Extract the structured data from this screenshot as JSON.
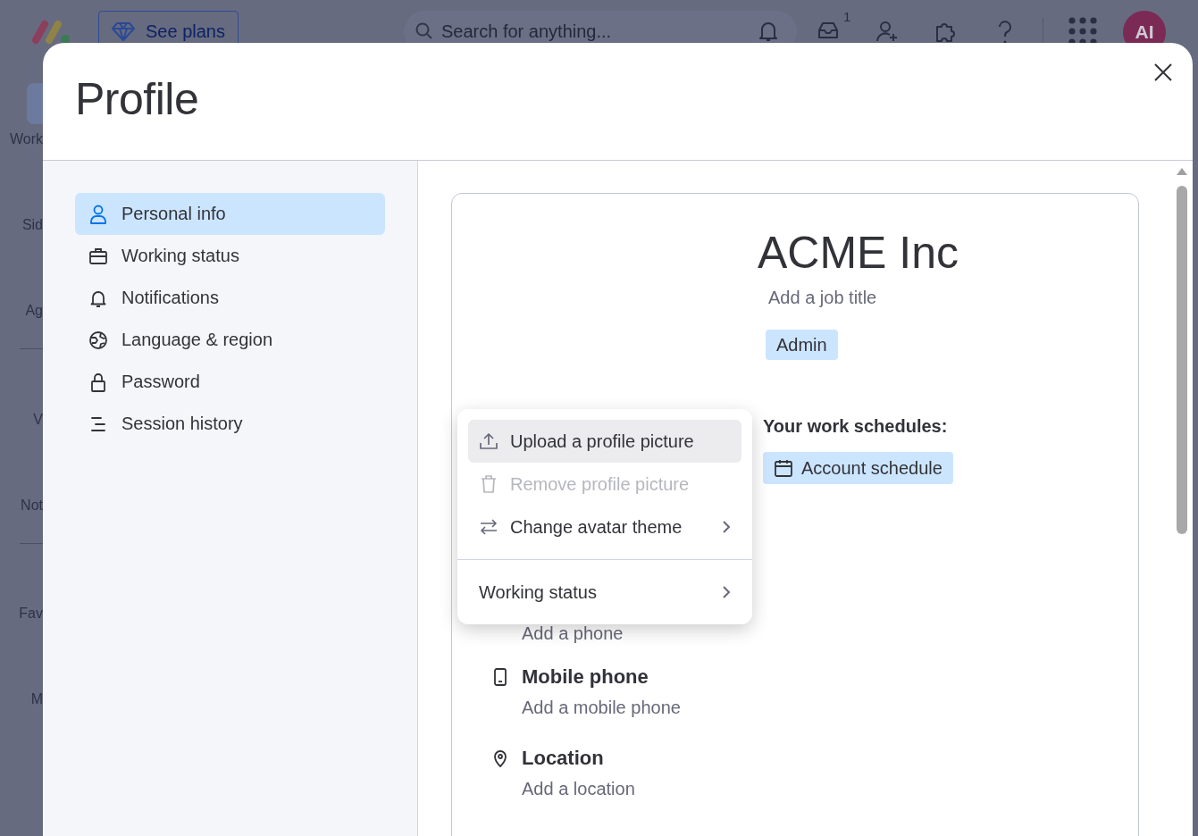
{
  "topbar": {
    "see_plans": "See plans",
    "search": {
      "placeholder": "Search for anything..."
    },
    "inbox_badge": "1",
    "avatar": "AI"
  },
  "app_sidebar": {
    "items": [
      {
        "label": "Work",
        "selected": true
      },
      {
        "label": "Sid",
        "selected": false
      },
      {
        "label": "Ag",
        "selected": false
      },
      {
        "label": "V",
        "selected": false
      },
      {
        "label": "Not",
        "selected": false
      },
      {
        "label": "Fav",
        "selected": false
      },
      {
        "label": "M",
        "selected": false
      }
    ]
  },
  "dialog": {
    "title": "Profile"
  },
  "nav": {
    "items": [
      {
        "kind": "person",
        "label": "Personal info",
        "selected": true
      },
      {
        "kind": "briefcase",
        "label": "Working status",
        "selected": false
      },
      {
        "kind": "bell",
        "label": "Notifications",
        "selected": false
      },
      {
        "kind": "globe",
        "label": "Language & region",
        "selected": false
      },
      {
        "kind": "lock",
        "label": "Password",
        "selected": false
      },
      {
        "kind": "lines",
        "label": "Session history",
        "selected": false
      }
    ]
  },
  "profile": {
    "name": "ACME Inc",
    "job_title": {
      "placeholder": "Add a job title"
    },
    "role": "Admin",
    "schedules_heading": "Your work schedules:",
    "schedules": [
      "Account schedule"
    ]
  },
  "fields": [
    {
      "kind": "phone",
      "placeholder": "Add a phone"
    },
    {
      "kind": "mobile",
      "label": "Mobile phone",
      "placeholder": "Add a mobile phone"
    },
    {
      "kind": "location",
      "label": "Location",
      "placeholder": "Add a location"
    }
  ],
  "menu": {
    "groups": [
      {
        "items": [
          {
            "kind": "upload",
            "label": "Upload a profile picture",
            "selected": true,
            "disabled": false,
            "submenu": false
          },
          {
            "kind": "trash",
            "label": "Remove profile picture",
            "selected": false,
            "disabled": true,
            "submenu": false
          },
          {
            "kind": "swap",
            "label": "Change avatar theme",
            "selected": false,
            "disabled": false,
            "submenu": true
          }
        ]
      },
      {
        "items": [
          {
            "kind": "none",
            "label": "Working status",
            "selected": false,
            "disabled": false,
            "submenu": true
          }
        ]
      }
    ]
  }
}
